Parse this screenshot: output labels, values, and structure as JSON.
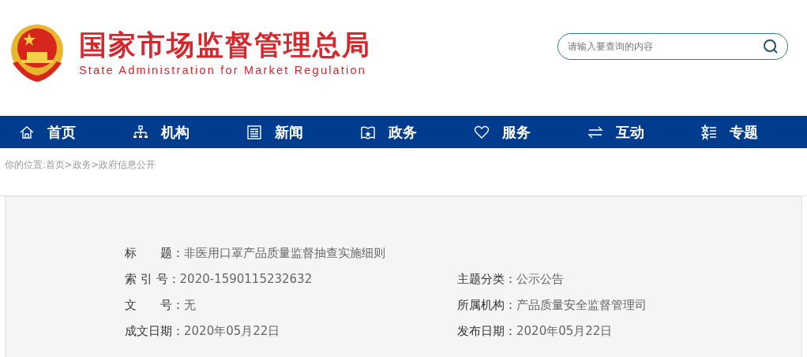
{
  "header": {
    "title": "国家市场监督管理总局",
    "subtitle": "State Administration for Market Regulation"
  },
  "search": {
    "placeholder": "请输入要查询的内容"
  },
  "nav": [
    {
      "label": "首页",
      "kind": "home"
    },
    {
      "label": "机构",
      "kind": "org"
    },
    {
      "label": "新闻",
      "kind": "news"
    },
    {
      "label": "政务",
      "kind": "book"
    },
    {
      "label": "服务",
      "kind": "heart"
    },
    {
      "label": "互动",
      "kind": "swap"
    },
    {
      "label": "专题",
      "kind": "stars"
    }
  ],
  "breadcrumb": "你的位置:首页>政务>政府信息公开",
  "info": [
    [
      {
        "label": "标　　题：",
        "value": "非医用口罩产品质量监督抽查实施细则"
      }
    ],
    [
      {
        "label": "索 引 号：",
        "value": "2020-1590115232632"
      },
      {
        "label": "主题分类：",
        "value": "公示公告"
      }
    ],
    [
      {
        "label": "文　　号：",
        "value": "无"
      },
      {
        "label": "所属机构：",
        "value": "产品质量安全监督管理司"
      }
    ],
    [
      {
        "label": "成文日期：",
        "value": "2020年05月22日"
      },
      {
        "label": "发布日期：",
        "value": "2020年05月22日"
      }
    ]
  ]
}
